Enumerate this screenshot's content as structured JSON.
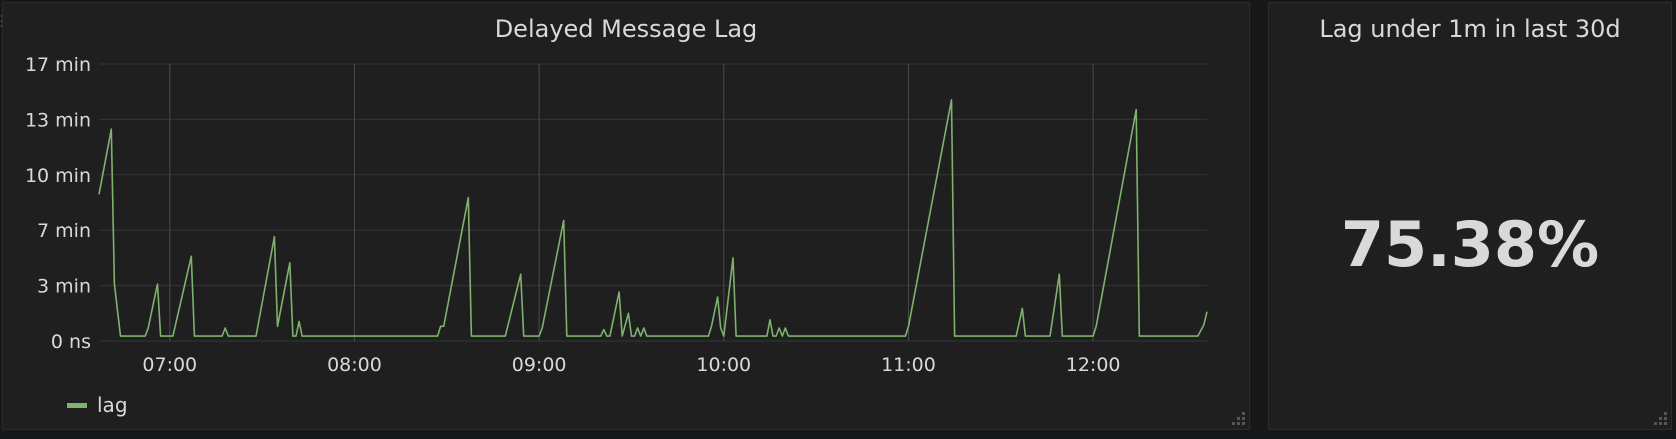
{
  "graph_panel": {
    "title": "Delayed Message Lag"
  },
  "stat_panel": {
    "title": "Lag under 1m in last 30d",
    "value": "75.38%"
  },
  "colors": {
    "series": "#7eb26d",
    "grid": "#333436",
    "vertical_grid": "#4a4b4d",
    "text": "#d8d9da",
    "panel_bg": "#1f1f20"
  },
  "chart_data": {
    "type": "line",
    "title": "Delayed Message Lag",
    "xlabel": "",
    "ylabel": "",
    "y_ticks": [
      "0 ns",
      "3 min",
      "7 min",
      "10 min",
      "13 min",
      "17 min"
    ],
    "x_ticks": [
      "07:00",
      "08:00",
      "09:00",
      "10:00",
      "11:00",
      "12:00"
    ],
    "xlim": [
      "06:37",
      "12:37"
    ],
    "ylim": [
      0,
      17
    ],
    "grid": true,
    "legend_position": "bottom-left",
    "series": [
      {
        "name": "lag",
        "color": "#7eb26d",
        "points": [
          [
            "06:37",
            9.0
          ],
          [
            "06:41",
            13.0
          ],
          [
            "06:42",
            3.5
          ],
          [
            "06:44",
            0.3
          ],
          [
            "06:52",
            0.3
          ],
          [
            "06:53",
            0.8
          ],
          [
            "06:56",
            3.5
          ],
          [
            "06:57",
            0.3
          ],
          [
            "07:01",
            0.3
          ],
          [
            "07:07",
            5.2
          ],
          [
            "07:08",
            0.3
          ],
          [
            "07:17",
            0.3
          ],
          [
            "07:18",
            0.8
          ],
          [
            "07:19",
            0.3
          ],
          [
            "07:28",
            0.3
          ],
          [
            "07:34",
            6.4
          ],
          [
            "07:35",
            0.9
          ],
          [
            "07:39",
            4.8
          ],
          [
            "07:40",
            0.3
          ],
          [
            "07:41",
            0.3
          ],
          [
            "07:42",
            1.2
          ],
          [
            "07:43",
            0.3
          ],
          [
            "08:27",
            0.3
          ],
          [
            "08:28",
            0.9
          ],
          [
            "08:29",
            0.9
          ],
          [
            "08:37",
            8.8
          ],
          [
            "08:38",
            0.3
          ],
          [
            "08:49",
            0.3
          ],
          [
            "08:54",
            4.1
          ],
          [
            "08:55",
            0.3
          ],
          [
            "09:00",
            0.3
          ],
          [
            "09:01",
            0.8
          ],
          [
            "09:08",
            7.4
          ],
          [
            "09:09",
            0.3
          ],
          [
            "09:20",
            0.3
          ],
          [
            "09:21",
            0.7
          ],
          [
            "09:22",
            0.3
          ],
          [
            "09:23",
            0.3
          ],
          [
            "09:26",
            3.0
          ],
          [
            "09:27",
            0.3
          ],
          [
            "09:29",
            1.7
          ],
          [
            "09:30",
            0.3
          ],
          [
            "09:31",
            0.3
          ],
          [
            "09:32",
            0.8
          ],
          [
            "09:33",
            0.3
          ],
          [
            "09:34",
            0.8
          ],
          [
            "09:35",
            0.3
          ],
          [
            "09:55",
            0.3
          ],
          [
            "09:56",
            0.9
          ],
          [
            "09:58",
            2.7
          ],
          [
            "09:59",
            0.8
          ],
          [
            "10:00",
            0.3
          ],
          [
            "10:03",
            5.1
          ],
          [
            "10:04",
            0.3
          ],
          [
            "10:14",
            0.3
          ],
          [
            "10:15",
            1.3
          ],
          [
            "10:16",
            0.3
          ],
          [
            "10:17",
            0.3
          ],
          [
            "10:18",
            0.8
          ],
          [
            "10:19",
            0.3
          ],
          [
            "10:20",
            0.8
          ],
          [
            "10:21",
            0.3
          ],
          [
            "10:59",
            0.3
          ],
          [
            "11:00",
            0.9
          ],
          [
            "11:14",
            14.8
          ],
          [
            "11:15",
            0.3
          ],
          [
            "11:35",
            0.3
          ],
          [
            "11:37",
            2.0
          ],
          [
            "11:38",
            0.3
          ],
          [
            "11:46",
            0.3
          ],
          [
            "11:49",
            4.1
          ],
          [
            "11:50",
            0.3
          ],
          [
            "12:00",
            0.3
          ],
          [
            "12:01",
            0.9
          ],
          [
            "12:14",
            14.2
          ],
          [
            "12:15",
            0.3
          ],
          [
            "12:34",
            0.3
          ],
          [
            "12:36",
            1.0
          ],
          [
            "12:37",
            1.8
          ]
        ]
      }
    ]
  }
}
